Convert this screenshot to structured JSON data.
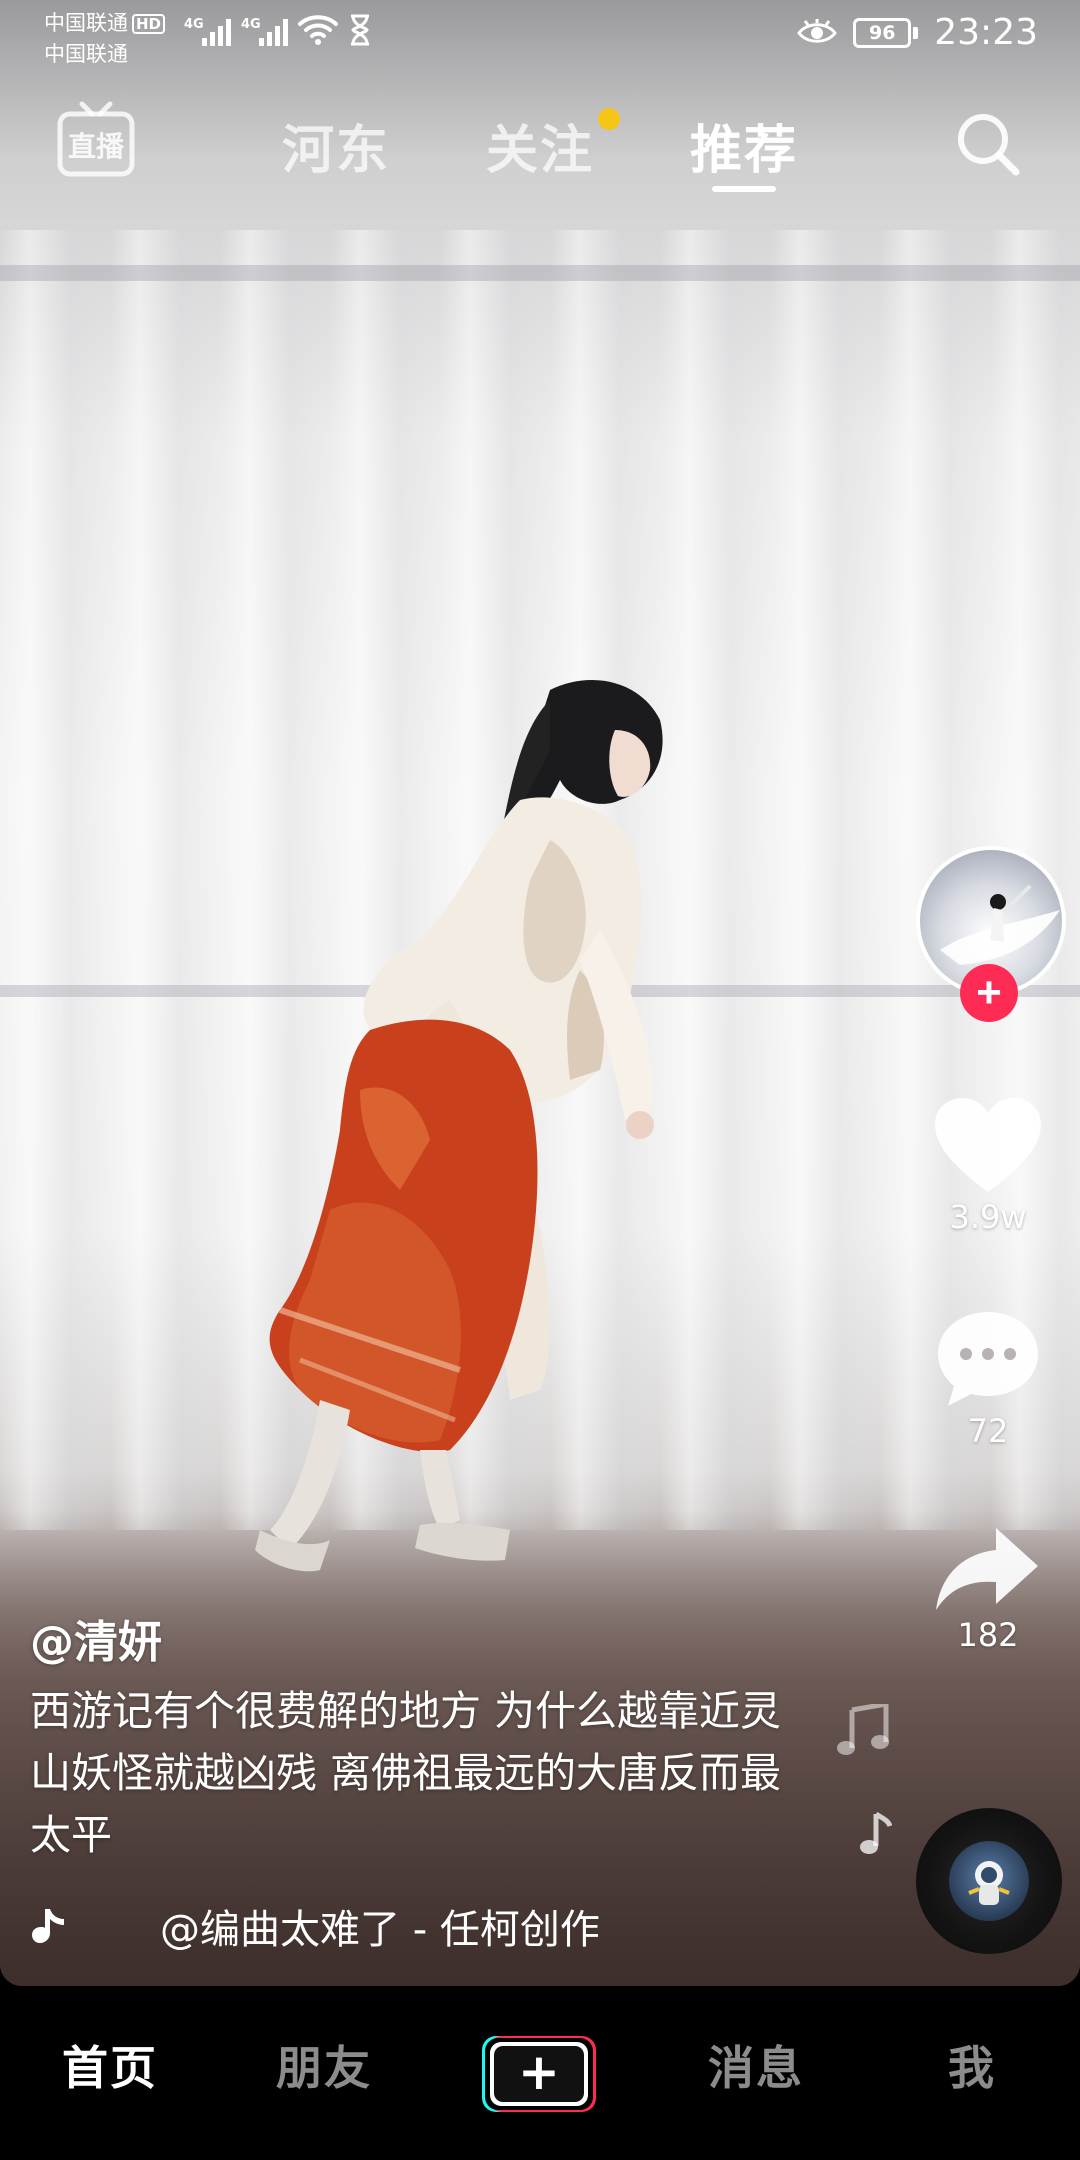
{
  "status_bar": {
    "carrier_1": "中国联通",
    "carrier_1_badge": "HD",
    "carrier_2": "中国联通",
    "network_1": "4G",
    "network_2": "4G",
    "battery": "96",
    "time": "23:23"
  },
  "top_nav": {
    "live_label": "直播",
    "tabs": [
      {
        "label": "河东"
      },
      {
        "label": "关注"
      },
      {
        "label": "推荐"
      }
    ],
    "active_tab": "推荐",
    "follow_tab_has_notification": true,
    "search_icon": "search-icon"
  },
  "video": {
    "author": "@清妍",
    "caption": "西游记有个很费解的地方 为什么越靠近灵山妖怪就越凶残 离佛祖最远的大唐反而最太平",
    "music": "@编曲太难了 - 任柯创作"
  },
  "actions": {
    "likes": "3.9w",
    "comments": "72",
    "shares": "182"
  },
  "bottom_nav": {
    "tabs": [
      {
        "label": "首页"
      },
      {
        "label": "朋友"
      },
      {
        "label": "消息"
      },
      {
        "label": "我"
      }
    ],
    "active_tab": "首页",
    "create_symbol": "+"
  },
  "colors": {
    "accent_red": "#fe2c55",
    "notification_dot": "#f5c518",
    "create_cyan": "#25f4ee",
    "create_pink": "#fe2c55"
  }
}
